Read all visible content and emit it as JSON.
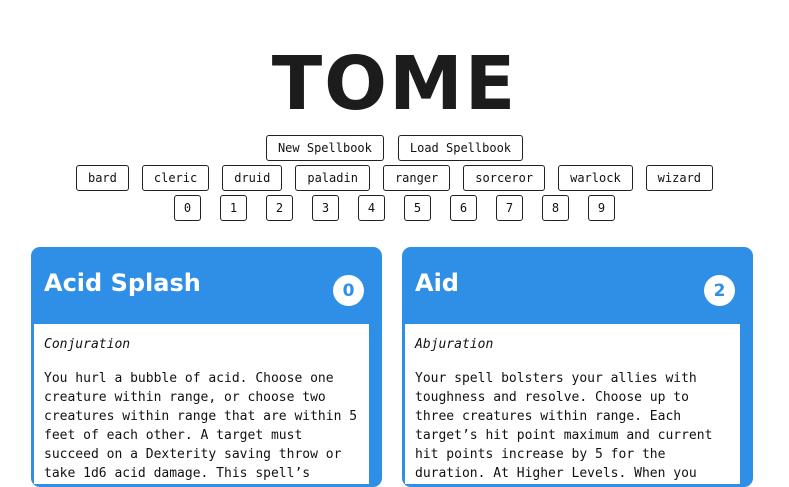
{
  "app": {
    "title": "TOME"
  },
  "spellbook_buttons": [
    "New Spellbook",
    "Load Spellbook"
  ],
  "class_filters": [
    "bard",
    "cleric",
    "druid",
    "paladin",
    "ranger",
    "sorceror",
    "warlock",
    "wizard"
  ],
  "level_filters": [
    "0",
    "1",
    "2",
    "3",
    "4",
    "5",
    "6",
    "7",
    "8",
    "9"
  ],
  "cards": [
    {
      "name": "Acid Splash",
      "level": "0",
      "school": "Conjuration",
      "description": "You hurl a bubble of acid. Choose one creature within range, or choose two creatures within range that are within 5 feet of each other. A target must succeed on a Dexterity saving throw or take 1d6 acid damage. This spell’s damage increases"
    },
    {
      "name": "Aid",
      "level": "2",
      "school": "Abjuration",
      "description": "Your spell bolsters your allies with toughness and resolve. Choose up to three creatures within range. Each target’s hit point maximum and current hit points increase by 5 for the duration. At Higher Levels. When you cast this spell using a"
    }
  ],
  "colors": {
    "accent": "#2f8fe6",
    "text": "#111111",
    "logo": "#1c1c1c"
  }
}
